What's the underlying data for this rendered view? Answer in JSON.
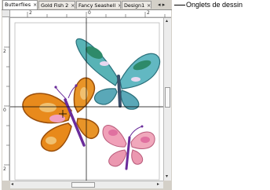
{
  "tabs": [
    {
      "label": "Butterflies",
      "active": true
    },
    {
      "label": "Gold Fish 2",
      "active": false
    },
    {
      "label": "Fancy Seashell",
      "active": false
    },
    {
      "label": "Design1",
      "active": false
    }
  ],
  "tab_close_glyph": "×",
  "tab_scroll_glyph": "◂ ▸",
  "ruler_top_labels": [
    "2",
    "0",
    "2"
  ],
  "ruler_left_labels": [
    "2",
    "0",
    "2"
  ],
  "callout": "Onglets de dessin",
  "colors": {
    "orange_butterfly": "#e88a1c",
    "teal_butterfly": "#4fa8b0",
    "pink_butterfly": "#f0a0b8",
    "body_purple": "#6a2c9a"
  }
}
